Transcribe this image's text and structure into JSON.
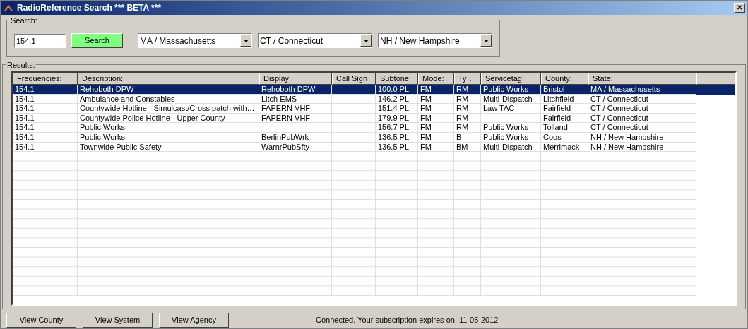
{
  "window": {
    "title": "RadioReference Search *** BETA ***",
    "close": "✕"
  },
  "search": {
    "legend": "Search:",
    "query": "154.1",
    "button": "Search",
    "states": [
      "MA / Massachusetts",
      "CT / Connecticut",
      "NH / New Hampshire"
    ]
  },
  "results": {
    "legend": "Results:",
    "columns": [
      "Frequencies:",
      "Description:",
      "Display:",
      "Call Sign",
      "Subtone:",
      "Mode:",
      "Ty…",
      "Servicetag:",
      "County:",
      "State:"
    ],
    "rows": [
      {
        "selected": true,
        "cells": [
          "154.1",
          "Rehoboth DPW",
          "Rehoboth DPW",
          "",
          "100.0 PL",
          "FM",
          "RM",
          "Public Works",
          "Bristol",
          "MA / Massachusetts"
        ]
      },
      {
        "selected": false,
        "cells": [
          "154.1",
          "Ambulance and Constables",
          "Litch EMS",
          "",
          "146.2 PL",
          "FM",
          "RM",
          "Multi-Dispatch",
          "Litchfield",
          "CT / Connecticut"
        ]
      },
      {
        "selected": false,
        "cells": [
          "154.1",
          "Countywide Hotline - Simulcast/Cross patch with…",
          "FAPERN VHF",
          "",
          "151.4 PL",
          "FM",
          "RM",
          "Law TAC",
          "Fairfield",
          "CT / Connecticut"
        ]
      },
      {
        "selected": false,
        "cells": [
          "154.1",
          "Countywide Police Hotline - Upper County",
          "FAPERN VHF",
          "",
          "179.9 PL",
          "FM",
          "RM",
          "",
          "Fairfield",
          "CT / Connecticut"
        ]
      },
      {
        "selected": false,
        "cells": [
          "154.1",
          "Public Works",
          "",
          "",
          "156.7 PL",
          "FM",
          "RM",
          "Public Works",
          "Tolland",
          "CT / Connecticut"
        ]
      },
      {
        "selected": false,
        "cells": [
          "154.1",
          "Public Works",
          "BerlinPubWrk",
          "",
          "136.5 PL",
          "FM",
          "B",
          "Public Works",
          "Coos",
          "NH / New Hampshire"
        ]
      },
      {
        "selected": false,
        "cells": [
          "154.1",
          "Townwide Public Safety",
          "WarnrPubSfty",
          "",
          "136.5 PL",
          "FM",
          "BM",
          "Multi-Dispatch",
          "Merrimack",
          "NH / New Hampshire"
        ]
      }
    ]
  },
  "buttons": [
    "View County",
    "View System",
    "View Agency"
  ],
  "status": "Connected. Your subscription expires on: 11-05-2012"
}
